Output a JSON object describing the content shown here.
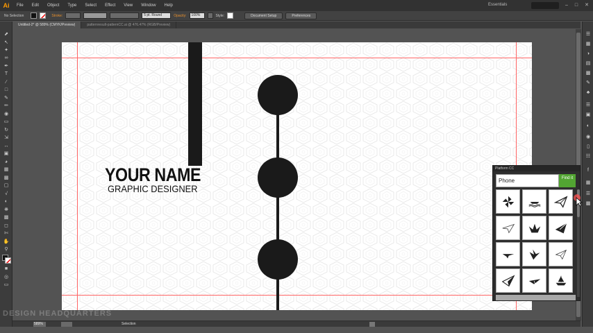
{
  "menubar": {
    "app_logo": "Ai",
    "items": [
      "File",
      "Edit",
      "Object",
      "Type",
      "Select",
      "Effect",
      "View",
      "Window",
      "Help"
    ],
    "workspace": "Essentials"
  },
  "controlbar": {
    "selection_label": "No Selection",
    "stroke_label": "Stroke:",
    "brush_label": "5 pt. Round",
    "opacity_label": "Opacity:",
    "opacity_value": "100%",
    "style_label": "Style:",
    "document_setup": "Document Setup",
    "preferences": "Preferences"
  },
  "tabs": [
    {
      "label": "Untitled-2* @ 589% (CMYK/Preview)",
      "active": true
    },
    {
      "label": "patternresult-patternCC.ai @ 476.47% (RGB/Preview)",
      "active": false
    }
  ],
  "artboard": {
    "name": "YOUR NAME",
    "title": "GRAPHIC DESIGNER"
  },
  "platform_panel": {
    "title": "Platform CC",
    "search_value": "Phone",
    "find_label": "Find it",
    "icons": [
      "pinwheel-icon",
      "boat-waves-icon",
      "paper-plane-icon",
      "paper-plane-outline-icon",
      "origami-crane-icon",
      "paper-plane-bold-icon",
      "paper-plane-dart-icon",
      "origami-bird-icon",
      "paper-plane-thin-icon",
      "paper-plane-fold-icon",
      "paper-plane-solid-icon",
      "paper-boat-icon"
    ]
  },
  "statusbar": {
    "zoom": "589%",
    "status": "Selection"
  },
  "watermark": "DESIGN HEADQUARTERS",
  "colors": {
    "accent": "#ff9a00",
    "find_button": "#52a532",
    "guide": "#ff6464",
    "ink": "#1a1a1a"
  }
}
